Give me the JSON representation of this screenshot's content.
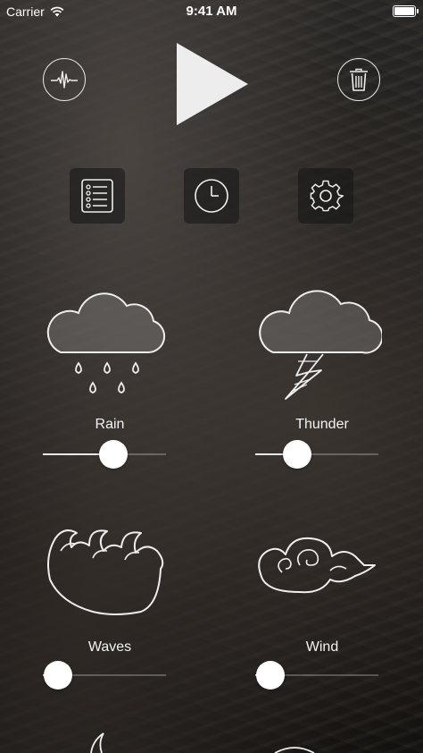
{
  "status_bar": {
    "carrier": "Carrier",
    "time": "9:41 AM"
  },
  "toolbar": {
    "left_icon": "waveform-icon",
    "center_icon": "play-icon",
    "right_icon": "trash-icon"
  },
  "menu": [
    {
      "icon": "list-icon"
    },
    {
      "icon": "clock-icon"
    },
    {
      "icon": "gear-icon"
    }
  ],
  "sounds": [
    {
      "label": "Rain",
      "icon": "rain-cloud-icon",
      "level": 0.57
    },
    {
      "label": "Thunder",
      "icon": "thunder-cloud-icon",
      "level": 0.34
    },
    {
      "label": "Waves",
      "icon": "waves-icon",
      "level": 0.12
    },
    {
      "label": "Wind",
      "icon": "wind-icon",
      "level": 0.12
    }
  ]
}
